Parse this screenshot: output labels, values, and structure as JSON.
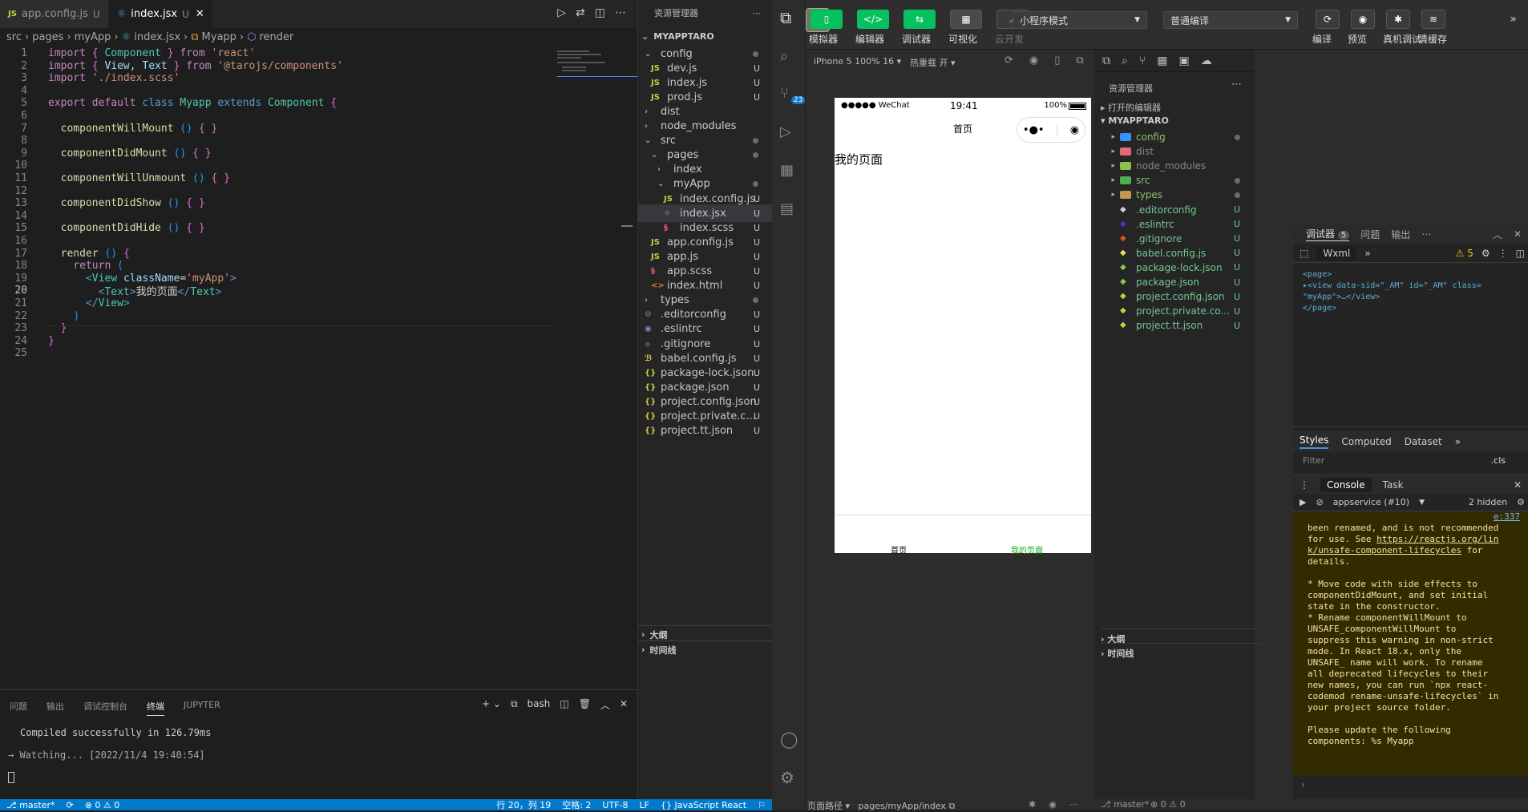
{
  "vscode": {
    "tabs": [
      {
        "name": "app.config.js",
        "status": "U"
      },
      {
        "name": "index.jsx",
        "status": "U"
      }
    ],
    "breadcrumb": [
      "src",
      "pages",
      "myApp",
      "index.jsx",
      "Myapp",
      "render"
    ],
    "code": [
      "import { Component } from 'react'",
      "import { View, Text } from '@tarojs/components'",
      "import './index.scss'",
      "",
      "export default class Myapp extends Component {",
      "",
      "  componentWillMount () { }",
      "",
      "  componentDidMount () { }",
      "",
      "  componentWillUnmount () { }",
      "",
      "  componentDidShow () { }",
      "",
      "  componentDidHide () { }",
      "",
      "  render () {",
      "    return (",
      "      <View className='myApp'>",
      "        <Text>我的页面</Text>",
      "      </View>",
      "    )",
      "  }",
      "}",
      ""
    ],
    "current_line": 20,
    "panel_tabs": [
      "问题",
      "输出",
      "调试控制台",
      "终端",
      "JUPYTER"
    ],
    "panel_active": "终端",
    "shell": "bash",
    "terminal_lines": [
      "Compiled successfully in 126.79ms",
      "→ Watching... [2022/11/4 19:40:54]"
    ],
    "status": {
      "branch": "master*",
      "errors": "⊗ 0 ⚠ 0",
      "position": "行 20，列 19",
      "spaces": "空格: 2",
      "encoding": "UTF-8",
      "eol": "LF",
      "language": "{} JavaScript React"
    }
  },
  "explorer": {
    "title": "资源管理器",
    "root": "MYAPPTARO",
    "items": [
      {
        "label": "config",
        "kind": "folder-open",
        "depth": 1,
        "mark": "dot"
      },
      {
        "label": "dev.js",
        "kind": "js",
        "depth": 2,
        "mark": "U"
      },
      {
        "label": "index.js",
        "kind": "js",
        "depth": 2,
        "mark": "U"
      },
      {
        "label": "prod.js",
        "kind": "js",
        "depth": 2,
        "mark": "U"
      },
      {
        "label": "dist",
        "kind": "folder",
        "depth": 1,
        "mark": ""
      },
      {
        "label": "node_modules",
        "kind": "folder",
        "depth": 1,
        "mark": ""
      },
      {
        "label": "src",
        "kind": "folder-open",
        "depth": 1,
        "mark": "dot"
      },
      {
        "label": "pages",
        "kind": "folder-open",
        "depth": 2,
        "mark": "dot"
      },
      {
        "label": "index",
        "kind": "folder",
        "depth": 3,
        "mark": ""
      },
      {
        "label": "myApp",
        "kind": "folder-open",
        "depth": 3,
        "mark": "dot"
      },
      {
        "label": "index.config.js",
        "kind": "js",
        "depth": 4,
        "mark": "U"
      },
      {
        "label": "index.jsx",
        "kind": "jsx",
        "depth": 4,
        "mark": "U"
      },
      {
        "label": "index.scss",
        "kind": "scss",
        "depth": 4,
        "mark": "U"
      },
      {
        "label": "app.config.js",
        "kind": "js",
        "depth": 2,
        "mark": "U"
      },
      {
        "label": "app.js",
        "kind": "js",
        "depth": 2,
        "mark": "U"
      },
      {
        "label": "app.scss",
        "kind": "scss",
        "depth": 2,
        "mark": "U"
      },
      {
        "label": "index.html",
        "kind": "html",
        "depth": 2,
        "mark": "U"
      },
      {
        "label": "types",
        "kind": "folder",
        "depth": 1,
        "mark": "dot"
      },
      {
        "label": ".editorconfig",
        "kind": "gear",
        "depth": 1,
        "mark": "U"
      },
      {
        "label": ".eslintrc",
        "kind": "eslint",
        "depth": 1,
        "mark": "U"
      },
      {
        "label": ".gitignore",
        "kind": "git",
        "depth": 1,
        "mark": "U"
      },
      {
        "label": "babel.config.js",
        "kind": "babel",
        "depth": 1,
        "mark": "U"
      },
      {
        "label": "package-lock.json",
        "kind": "json",
        "depth": 1,
        "mark": "U"
      },
      {
        "label": "package.json",
        "kind": "json",
        "depth": 1,
        "mark": "U"
      },
      {
        "label": "project.config.json",
        "kind": "json",
        "depth": 1,
        "mark": "U"
      },
      {
        "label": "project.private.c...",
        "kind": "json",
        "depth": 1,
        "mark": "U"
      },
      {
        "label": "project.tt.json",
        "kind": "json",
        "depth": 1,
        "mark": "U"
      }
    ],
    "outline": "大纲",
    "timeline": "时间线"
  },
  "wechat": {
    "toolbar_buttons": [
      {
        "label": "模拟器",
        "glyph": "▯"
      },
      {
        "label": "编辑器",
        "glyph": "</>"
      },
      {
        "label": "调试器",
        "glyph": "⇆"
      },
      {
        "label": "可视化",
        "glyph": "▦"
      },
      {
        "label": "云开发",
        "glyph": "☁"
      }
    ],
    "mode_select": "小程序模式",
    "compile_select": "普通编译",
    "right_buttons": [
      "编译",
      "预览",
      "真机调试",
      "清缓存"
    ],
    "device": "iPhone 5 100% 16",
    "hotreload": "热重载 开",
    "phone": {
      "carrier": "●●●●● WeChat",
      "time": "19:41",
      "battery": "100%",
      "nav_title": "首页",
      "content": "我的页面",
      "tab_home": "首页",
      "tab_mine": "我的页面"
    },
    "res_title": "资源管理器",
    "open_editors": "打开的编辑器",
    "root": "MYAPPTARO",
    "files": [
      {
        "label": "config",
        "color": "#3794ff",
        "mark": "dot"
      },
      {
        "label": "dist",
        "color": "#e06c75",
        "mark": ""
      },
      {
        "label": "node_modules",
        "color": "#8bc34a",
        "mark": ""
      },
      {
        "label": "src",
        "color": "#4caf50",
        "mark": "dot"
      },
      {
        "label": "types",
        "color": "#c09553",
        "mark": "dot"
      },
      {
        "label": ".editorconfig",
        "color": "#ccc",
        "mark": "U"
      },
      {
        "label": ".eslintrc",
        "color": "#4b32c3",
        "mark": "U"
      },
      {
        "label": ".gitignore",
        "color": "#e44d26",
        "mark": "U"
      },
      {
        "label": "babel.config.js",
        "color": "#f5da55",
        "mark": "U"
      },
      {
        "label": "package-lock.json",
        "color": "#8bc34a",
        "mark": "U"
      },
      {
        "label": "package.json",
        "color": "#8bc34a",
        "mark": "U"
      },
      {
        "label": "project.config.json",
        "color": "#cbcb41",
        "mark": "U"
      },
      {
        "label": "project.private.co...",
        "color": "#cbcb41",
        "mark": "U"
      },
      {
        "label": "project.tt.json",
        "color": "#cbcb41",
        "mark": "U"
      }
    ],
    "outline": "大纲",
    "timeline": "时间线",
    "devtools": {
      "tabs": [
        "调试器",
        "问题",
        "输出"
      ],
      "badge": "5",
      "panel": "Wxml",
      "warn": "5",
      "wxml_lines": [
        "<page>",
        "▸<view data-sid=\"_AM\" id=\"_AM\" class=",
        "\"myApp\">…</view>",
        "</page>"
      ],
      "style_tabs": [
        "Styles",
        "Computed",
        "Dataset"
      ],
      "filter": "Filter",
      "cls": ".cls",
      "console_tabs": [
        "Console",
        "Task"
      ],
      "context": "appservice (#10)",
      "hidden": "2 hidden",
      "console_link_top": "e:337",
      "console_lines": [
        "been renamed, and is not recommended",
        "for use. See ",
        "https://reactjs.org/lin",
        "k/unsafe-component-lifecycles",
        " for",
        "details.",
        "",
        "* Move code with side effects to",
        "componentDidMount, and set initial",
        "state in the constructor.",
        "* Rename componentWillMount to",
        "UNSAFE_componentWillMount to",
        "suppress this warning in non-strict",
        "mode. In React 18.x, only the",
        "UNSAFE_ name will work. To rename",
        "all deprecated lifecycles to their",
        "new names, you can run `npx react-",
        "codemod rename-unsafe-lifecycles` in",
        "your project source folder.",
        "",
        "Please update the following",
        "components: %s Myapp"
      ]
    },
    "bottom": {
      "path_label": "页面路径",
      "path": "pages/myApp/index",
      "branch": "master*",
      "errors": "⊗ 0 ⚠ 0"
    }
  }
}
